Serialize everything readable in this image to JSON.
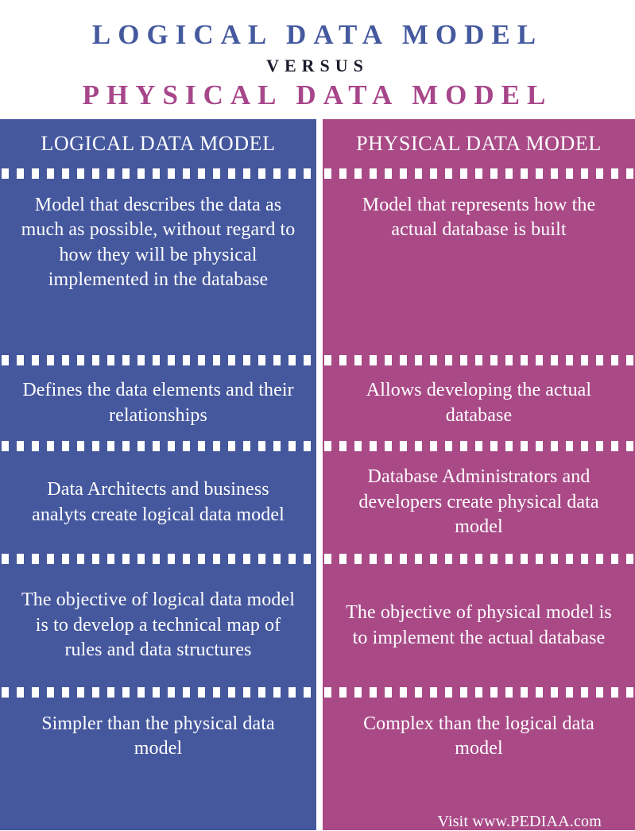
{
  "title": {
    "main": "LOGICAL DATA MODEL",
    "versus": "VERSUS",
    "sub": "PHYSICAL DATA MODEL"
  },
  "colors": {
    "logical_blue": "#45589e",
    "physical_magenta": "#a94a87",
    "title_blue": "#44599e",
    "title_magenta": "#a7468a",
    "versus_dark": "#1a1c2c",
    "divider_white": "#ffffff",
    "text_white": "#ffffff"
  },
  "table": {
    "columns": [
      {
        "header": "LOGICAL DATA MODEL",
        "rows": [
          "Model that describes the data as much as possible, without regard to how they will be physical implemented in the database",
          "Defines the data elements and their relationships",
          "Data Architects and business analyts create logical data model",
          "The objective of logical data model is to develop a technical map of rules and data structures",
          "Simpler than the physical data model"
        ]
      },
      {
        "header": "PHYSICAL DATA MODEL",
        "rows": [
          "Model that represents how the actual database is built",
          "Allows developing the actual database",
          "Database Administrators and developers create physical data model",
          "The objective of physical model is to implement the actual database",
          "Complex than the logical data model"
        ]
      }
    ]
  },
  "attribution": "Visit www.PEDIAA.com"
}
